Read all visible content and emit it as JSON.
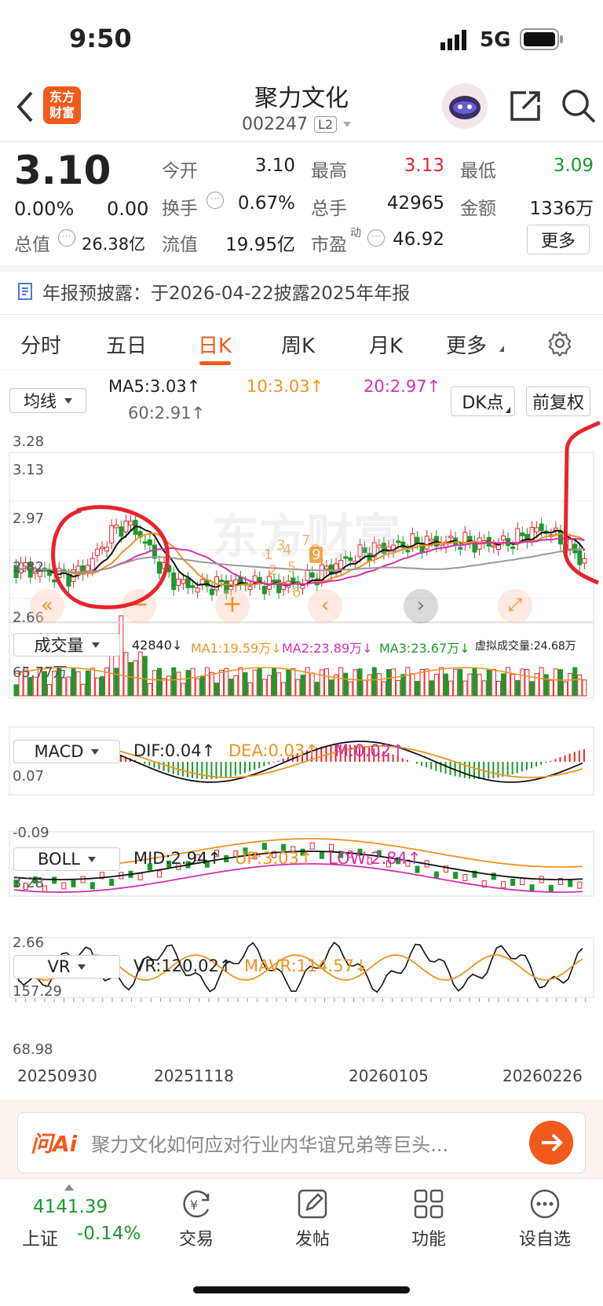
{
  "status_bar": {
    "time": "9:50",
    "network": "5G"
  },
  "header": {
    "title": "聚力文化",
    "code": "002247",
    "level": "L2",
    "logo_text": "东方财富"
  },
  "quote": {
    "price": "3.10",
    "change_pct": "0.00%",
    "change": "0.00",
    "row1": {
      "open_label": "今开",
      "open": "3.10",
      "high_label": "最高",
      "high": "3.13",
      "low_label": "最低",
      "low": "3.09"
    },
    "row2": {
      "turnover_label": "换手",
      "turnover": "0.67%",
      "volume_label": "总手",
      "volume": "42965",
      "amount_label": "金额",
      "amount": "1336万"
    },
    "row3": {
      "mcap_label": "总值",
      "mcap": "26.38亿",
      "float_label": "流值",
      "float": "19.95亿",
      "pe_label": "市盈",
      "pe_sup": "动",
      "pe": "46.92"
    },
    "more_button": "更多"
  },
  "notice": "年报预披露：于2026-04-22披露2025年年报",
  "tabs": [
    "分时",
    "五日",
    "日K",
    "周K",
    "月K",
    "更多"
  ],
  "active_tab": "日K",
  "kline": {
    "select": "均线",
    "ma5": "MA5:3.03↑",
    "ma10": "10:3.03↑",
    "ma20": "20:2.97↑",
    "ma60": "60:2.91↑",
    "dk_button": "DK点",
    "fq_button": "前复权",
    "y_labels": [
      "3.28",
      "3.13",
      "2.97",
      "2.82",
      "2.66"
    ],
    "watermark": "东方财富",
    "digits": [
      "1",
      "2",
      "3",
      "4",
      "5",
      "6",
      "7",
      "8",
      "9"
    ]
  },
  "volume": {
    "select": "成交量",
    "value": "42840↓",
    "ma1": "MA1:19.59万↓",
    "ma2": "MA2:23.89万↓",
    "ma3": "MA3:23.67万↓",
    "virtual": "虚拟成交量:24.68万",
    "y_label": "65.77万"
  },
  "macd": {
    "select": "MACD",
    "dif": "DIF:0.04↑",
    "dea": "DEA:0.03↑",
    "m": "M:0.02↑",
    "y_top": "0.07",
    "y_bottom": "-0.09"
  },
  "boll": {
    "select": "BOLL",
    "mid": "MID:2.94↑",
    "up": "UP:3.03↑",
    "low": "LOW:2.84↑",
    "y_top": "3.28",
    "y_bottom": "2.66"
  },
  "vr": {
    "select": "VR",
    "vr": "VR:120.02↑",
    "mavr": "MAVR:114.57↓",
    "y_top": "157.29",
    "y_bottom": "68.98"
  },
  "dates": [
    "20250930",
    "20251118",
    "20260105",
    "20260226"
  ],
  "ai_bar": {
    "logo": "问Ai",
    "text": "聚力文化如何应对行业内华谊兄弟等巨头..."
  },
  "bottom_nav": {
    "index_value": "4141.39",
    "index_name": "上证",
    "index_change": "-0.14%",
    "items": [
      "交易",
      "发帖",
      "功能",
      "设自选"
    ]
  },
  "colors": {
    "up": "#e8242c",
    "down": "#1a9a2a",
    "ma10": "#f0921e",
    "ma20": "#d42fb0",
    "ma60": "#888888",
    "accent": "#f25a1c"
  }
}
